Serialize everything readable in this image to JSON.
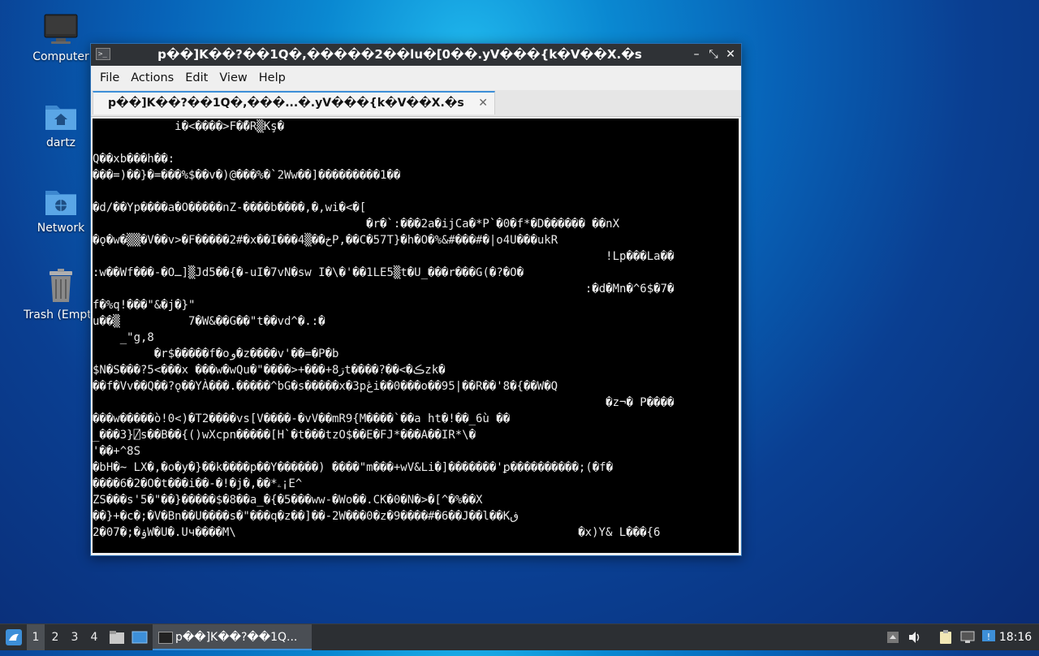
{
  "desktop": {
    "icons": [
      {
        "label": "Computer",
        "icon": "computer-icon"
      },
      {
        "label": "dartz",
        "icon": "home-folder-icon"
      },
      {
        "label": "Network",
        "icon": "network-folder-icon"
      },
      {
        "label": "Trash (Empty)",
        "icon": "trash-icon"
      }
    ]
  },
  "window": {
    "title": "p��]K��?��1Q�,�����2��lu�[0��.yV���{k�V��X.�s",
    "menu": [
      "File",
      "Actions",
      "Edit",
      "View",
      "Help"
    ],
    "tab_label": "p��]K��?��1Q�,���...�.yV���{k�V��X.�s",
    "controls": {
      "minimize": "–",
      "maximize": "⤡",
      "close": "✕",
      "tab_close": "✕"
    },
    "terminal_lines": [
      "            i�<����>F��ّR▒Kş�",
      "",
      "Q��xb���h��:",
      "���=)��}�=���%$��v�)@���%�`2Ww��]���������1��",
      "",
      "�d/��Yp����a�O�����nZ-����b����,�,wi�<�[",
      "                                        �r�`:���2a�ijCa�*P`�0�f*�D������ ��nX",
      "�ǫ�w�▒▒�V��v>�F�����2#�x��I���4▒��خP,��C�57T}�h�O�%&#���#�|o4U���ukR",
      "                                                                           !Lp���La��",
      ":w��Wf���-�Oـ]▒Jd5��{�-uI�7vN�sw I�\\�'��1LE5▒t�U_���r���G(�?�O�",
      "                                                                        :�d�Mn�^6$�7�",
      "f�%q!���\"&�j�}\"",
      "u��▒          7�W&��G��\"t��vd^�.:�",
      "    _\"g,8",
      "         �r$�����f�oو�z����v'��=�P�b",
      "$N�S���?5<���x ���w�wQu�\"����>+���+8ڗt����?��<�ڪzk�",
      "��f�Vv��Q��?ǫ��YÀ���.�����^bG�s�����x�3pڠi��0���o��95|��R��'8�{��W�Q",
      "                                                                           �z¬� P����",
      "���w�����ò!0<)�T2����vs[V����-�vV��mR9{M����`��a ht�!��_6ù ��",
      "_���3}⍁s��B��{()wXcpn�����[H`�t���tzO$��E�FJ*���A��IR*\\�",
      "'��+^8S",
      "�bH�~ LX�,�o�y�}��k����p��Y������) ����\"m���+wV&Li�]�������'ꝑ����������;(�f�",
      "����6�2�O�t���i��-�!�j�,��*ۦ¡E^",
      "ZS���s'5�\"��}�����$�8��a_�{�5���ww-�Wo��.CK�0�N�>�[^�%��X",
      "��}+�c�;�V�Bn��U����s�\"���q�z��]��-2W���0�z�9����#�6��J��l��Kڧ",
      "2�07�;�ۏW�U�.Uч����M\\                                                  �x)Y& L���{6"
    ]
  },
  "taskbar": {
    "workspaces": [
      "1",
      "2",
      "3",
      "4"
    ],
    "active_workspace": "1",
    "task_label": "p��]K��?��1Q...",
    "clock": "18:16"
  }
}
